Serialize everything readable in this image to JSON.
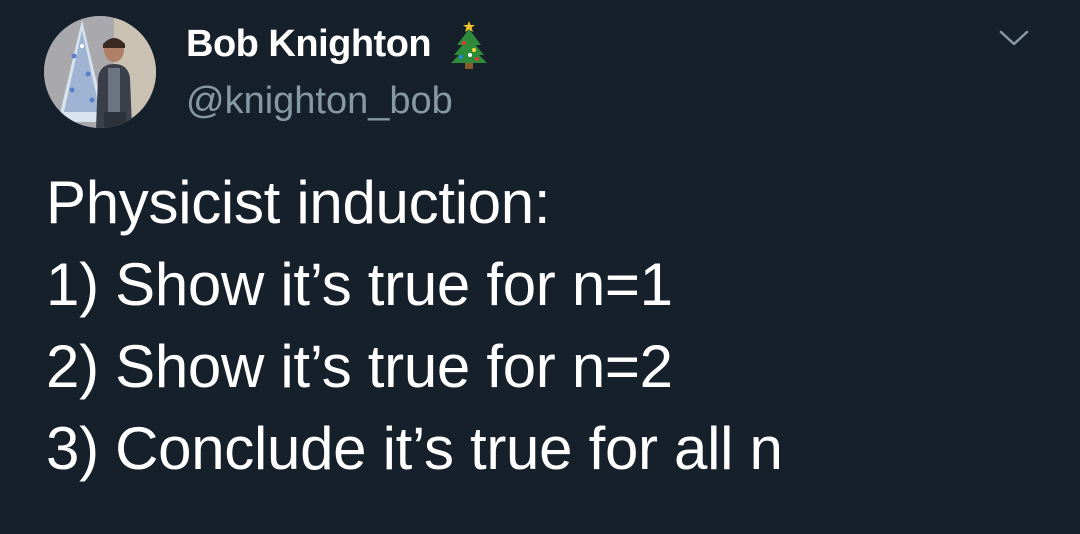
{
  "tweet": {
    "author": {
      "display_name": "Bob Knighton",
      "handle": "@knighton_bob",
      "name_emoji_icon": "christmas-tree-icon"
    },
    "menu_icon": "chevron-down-icon",
    "lines": [
      "Physicist induction:",
      "1) Show it’s true for n=1",
      "2) Show it’s true for n=2",
      "3) Conclude it’s true for all n"
    ]
  },
  "colors": {
    "background": "#15202b",
    "primary_text": "#ffffff",
    "secondary_text": "#8899a6"
  }
}
